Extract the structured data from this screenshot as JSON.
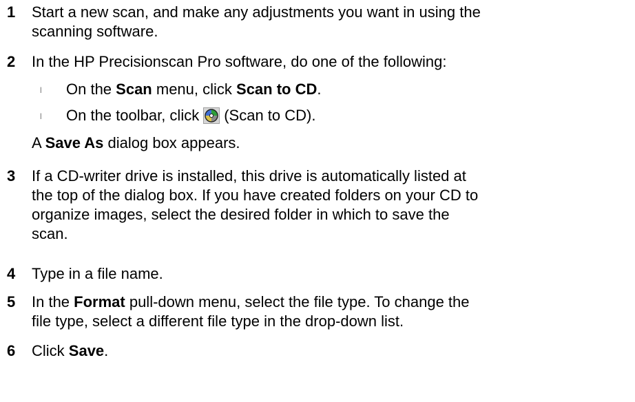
{
  "steps": [
    {
      "number": "1",
      "lines": [
        "Start a new scan, and make any adjustments you want in using the",
        "scanning software."
      ]
    },
    {
      "number": "2",
      "text": "In the HP Precisionscan Pro software, do one of the following:",
      "bullet_glyph": "l",
      "bullets": [
        {
          "pre": "On the ",
          "bold1": "Scan",
          "mid": " menu, click ",
          "bold2": "Scan to CD",
          "post": "."
        },
        {
          "pre": "On the toolbar, click",
          "icon": "scan-to-cd-icon",
          "post": "(Scan to CD)."
        }
      ],
      "after": {
        "pre": "A ",
        "bold": "Save As",
        "post": " dialog box appears."
      }
    },
    {
      "number": "3",
      "lines": [
        "If a CD-writer drive is installed, this drive is automatically listed at",
        "the top of the dialog box. If you have created folders on your CD to",
        "organize images, select the desired folder in which to save the",
        "scan."
      ]
    },
    {
      "number": "4",
      "lines": [
        "Type in a file name."
      ]
    },
    {
      "number": "5",
      "line1": {
        "pre": "In the ",
        "bold": "Format",
        "post": " pull-down menu, select the file type. To change the"
      },
      "line2": "file type, select a different file type in the drop-down list."
    },
    {
      "number": "6",
      "text": {
        "pre": "Click ",
        "bold": "Save",
        "post": "."
      }
    }
  ]
}
